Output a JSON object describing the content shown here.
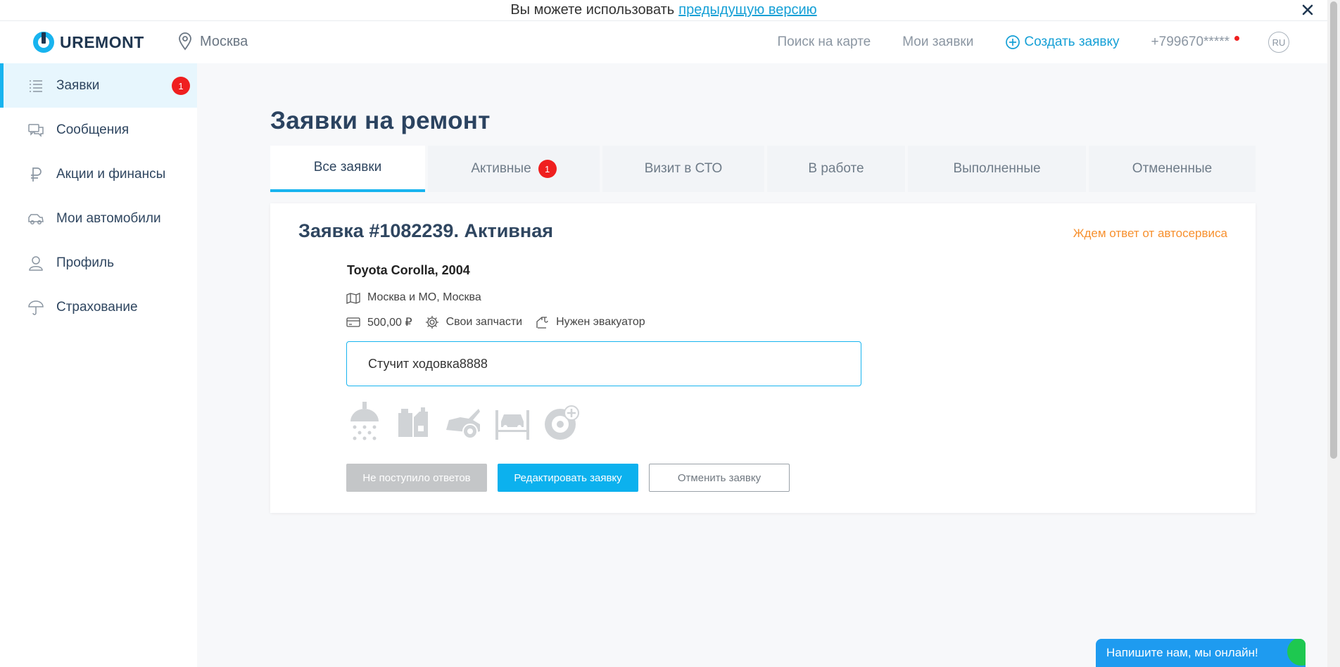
{
  "banner": {
    "text": "Вы можете использовать",
    "link": "предыдущую версию",
    "close_icon": "close-icon"
  },
  "header": {
    "logo_text": "UREMONT",
    "city": "Москва",
    "nav": {
      "map_search": "Поиск на карте",
      "my_requests": "Мои заявки",
      "create_request": "Создать заявку",
      "phone": "+799670*****",
      "lang": "RU"
    }
  },
  "sidebar": {
    "items": [
      {
        "label": "Заявки",
        "icon": "list-icon",
        "badge": "1"
      },
      {
        "label": "Сообщения",
        "icon": "messages-icon"
      },
      {
        "label": "Акции и финансы",
        "icon": "ruble-icon"
      },
      {
        "label": "Мои автомобили",
        "icon": "car-icon"
      },
      {
        "label": "Профиль",
        "icon": "user-icon"
      },
      {
        "label": "Страхование",
        "icon": "umbrella-icon"
      }
    ]
  },
  "main": {
    "title": "Заявки на ремонт",
    "tabs": [
      {
        "label": "Все заявки",
        "active": true
      },
      {
        "label": "Активные",
        "badge": "1"
      },
      {
        "label": "Визит в СТО"
      },
      {
        "label": "В работе"
      },
      {
        "label": "Выполненные"
      },
      {
        "label": "Отмененные"
      }
    ],
    "request": {
      "title": "Заявка #1082239.",
      "state": "Активная",
      "status": "Ждем ответ от автосервиса",
      "car": "Toyota Corolla, 2004",
      "location": "Москва и МО, Москва",
      "price": "500,00 ₽",
      "parts": "Свои запчасти",
      "tow": "Нужен эвакуатор",
      "description": "Стучит ходовка8888",
      "service_icons": [
        "car-wash-icon",
        "oil-change-icon",
        "engine-icon",
        "lift-icon",
        "tire-service-icon"
      ],
      "buttons": {
        "no_answers": "Не поступило ответов",
        "edit": "Редактировать заявку",
        "cancel": "Отменить заявку"
      }
    }
  },
  "chat": {
    "label": "Напишите нам, мы онлайн!"
  },
  "colors": {
    "accent": "#18b4ef",
    "status_orange": "#f7902e",
    "badge_red": "#ef1f1f",
    "title_dark": "#2b4360"
  }
}
